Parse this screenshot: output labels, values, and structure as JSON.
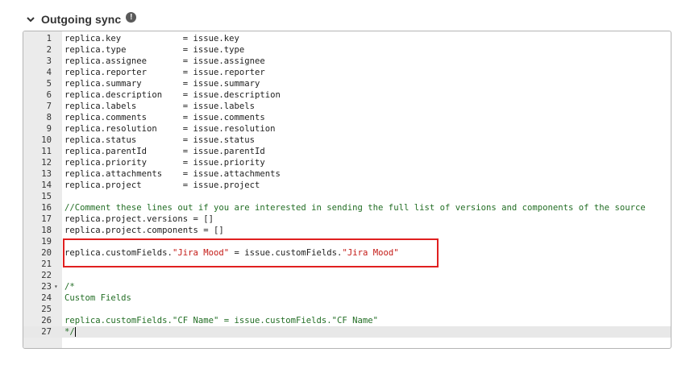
{
  "section": {
    "title": "Outgoing sync",
    "info_glyph": "!"
  },
  "editor": {
    "lines": [
      {
        "n": "1",
        "text": "replica.key            = issue.key"
      },
      {
        "n": "2",
        "text": "replica.type           = issue.type"
      },
      {
        "n": "3",
        "text": "replica.assignee       = issue.assignee"
      },
      {
        "n": "4",
        "text": "replica.reporter       = issue.reporter"
      },
      {
        "n": "5",
        "text": "replica.summary        = issue.summary"
      },
      {
        "n": "6",
        "text": "replica.description    = issue.description"
      },
      {
        "n": "7",
        "text": "replica.labels         = issue.labels"
      },
      {
        "n": "8",
        "text": "replica.comments       = issue.comments"
      },
      {
        "n": "9",
        "text": "replica.resolution     = issue.resolution"
      },
      {
        "n": "10",
        "text": "replica.status         = issue.status"
      },
      {
        "n": "11",
        "text": "replica.parentId       = issue.parentId"
      },
      {
        "n": "12",
        "text": "replica.priority       = issue.priority"
      },
      {
        "n": "13",
        "text": "replica.attachments    = issue.attachments"
      },
      {
        "n": "14",
        "text": "replica.project        = issue.project"
      },
      {
        "n": "15",
        "text": ""
      },
      {
        "n": "16",
        "text": "//Comment these lines out if you are interested in sending the full list of versions and components of the source",
        "kind": "comment"
      },
      {
        "n": "17",
        "text": "replica.project.versions = []"
      },
      {
        "n": "18",
        "text": "replica.project.components = []"
      },
      {
        "n": "19",
        "text": ""
      },
      {
        "n": "20",
        "parts": [
          {
            "t": "replica.customFields."
          },
          {
            "t": "\"Jira Mood\"",
            "k": "str"
          },
          {
            "t": " = issue.customFields."
          },
          {
            "t": "\"Jira Mood\"",
            "k": "str"
          }
        ]
      },
      {
        "n": "21",
        "text": ""
      },
      {
        "n": "22",
        "text": ""
      },
      {
        "n": "23",
        "text": "/*",
        "kind": "comment",
        "fold": true
      },
      {
        "n": "24",
        "text": "Custom Fields",
        "kind": "comment"
      },
      {
        "n": "25",
        "text": ""
      },
      {
        "n": "26",
        "text": "replica.customFields.\"CF Name\" = issue.customFields.\"CF Name\"",
        "kind": "comment"
      },
      {
        "n": "27",
        "text": "*/",
        "kind": "comment",
        "active": true
      }
    ]
  },
  "colors": {
    "highlight_border": "#e02020",
    "string": "#c41a16",
    "comment": "#236e25"
  }
}
